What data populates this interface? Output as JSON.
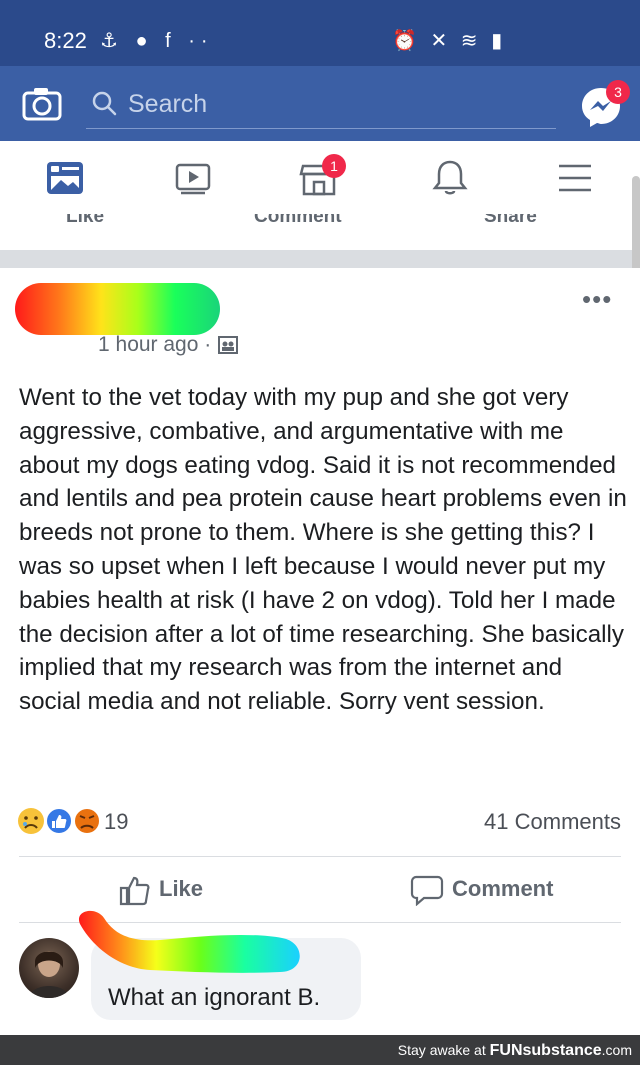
{
  "status_bar": {
    "time": "8:22",
    "left_icons": "⚓ ● f ··",
    "right_icons": "⏰ ✕ ≋ ▮"
  },
  "header": {
    "search_placeholder": "Search",
    "messenger_badge": "3",
    "background_color": "#3b5fa5"
  },
  "tabs": {
    "marketplace_badge": "1",
    "items": [
      "news-feed",
      "watch",
      "marketplace",
      "notifications",
      "menu"
    ]
  },
  "previous_post_actions": {
    "like": "Like",
    "comment": "Comment",
    "share": "Share"
  },
  "post": {
    "timestamp": "1 hour ago ·",
    "text": "Went to the vet today with my pup and she got very aggressive,  combative, and argumentative with me about my dogs eating vdog. Said it is not recommended and lentils and pea protein cause heart problems even in breeds not prone to them. Where is she getting this? I was so upset when I left because I would never put my babies health at risk (I have 2 on vdog). Told her I made the decision after a lot of time researching. She basically implied that my research was from the internet and social media and not reliable. Sorry vent session.",
    "reaction_count": "19",
    "comment_count": "41 Comments",
    "like_label": "Like",
    "comment_label": "Comment"
  },
  "comment": {
    "text": "What an ignorant B."
  },
  "footer": {
    "prefix": "Stay awake at ",
    "brand": "FUNsubstance",
    "suffix": ".com"
  }
}
